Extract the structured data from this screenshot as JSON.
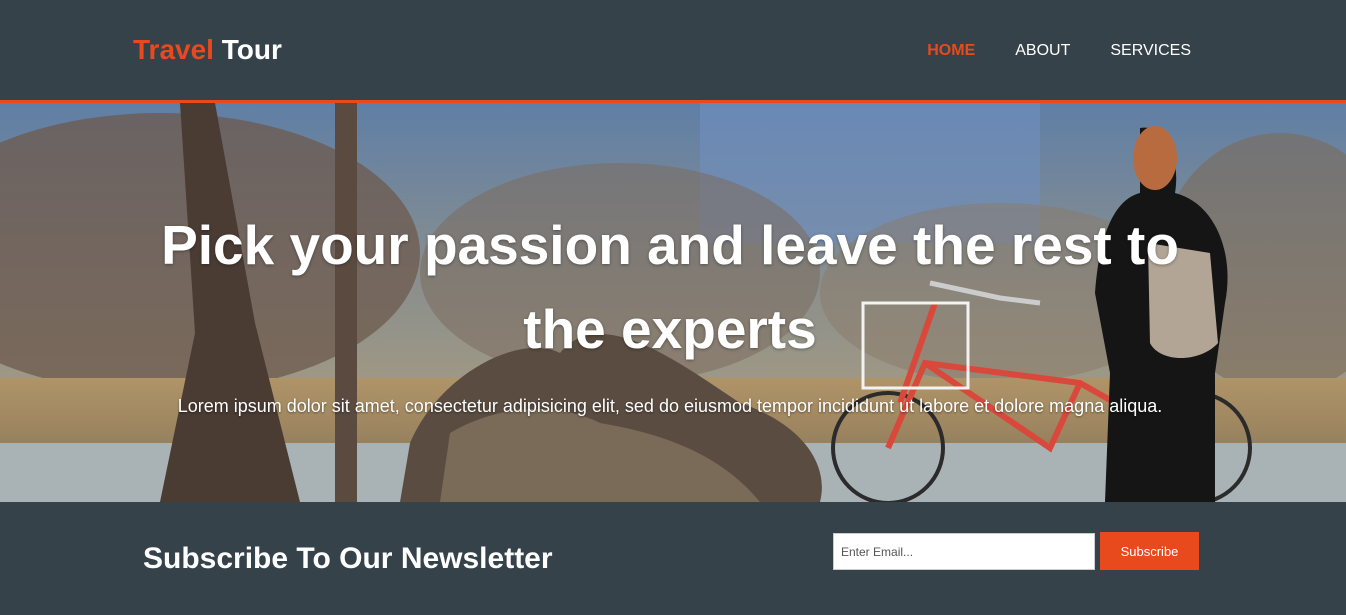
{
  "brand": {
    "highlight": "Travel",
    "rest": "Tour"
  },
  "nav": {
    "items": [
      {
        "label": "HOME",
        "active": true
      },
      {
        "label": "ABOUT",
        "active": false
      },
      {
        "label": "SERVICES",
        "active": false
      }
    ]
  },
  "hero": {
    "title": "Pick your passion and leave the rest to the experts",
    "text": "Lorem ipsum dolor sit amet, consectetur adipisicing elit, sed do eiusmod tempor incididunt ut labore et dolore magna aliqua."
  },
  "newsletter": {
    "heading": "Subscribe To Our Newsletter",
    "email_placeholder": "Enter Email...",
    "email_value": "",
    "button_label": "Subscribe"
  },
  "colors": {
    "accent": "#e8491d",
    "dark": "#35424a",
    "text_light": "#ffffff"
  }
}
